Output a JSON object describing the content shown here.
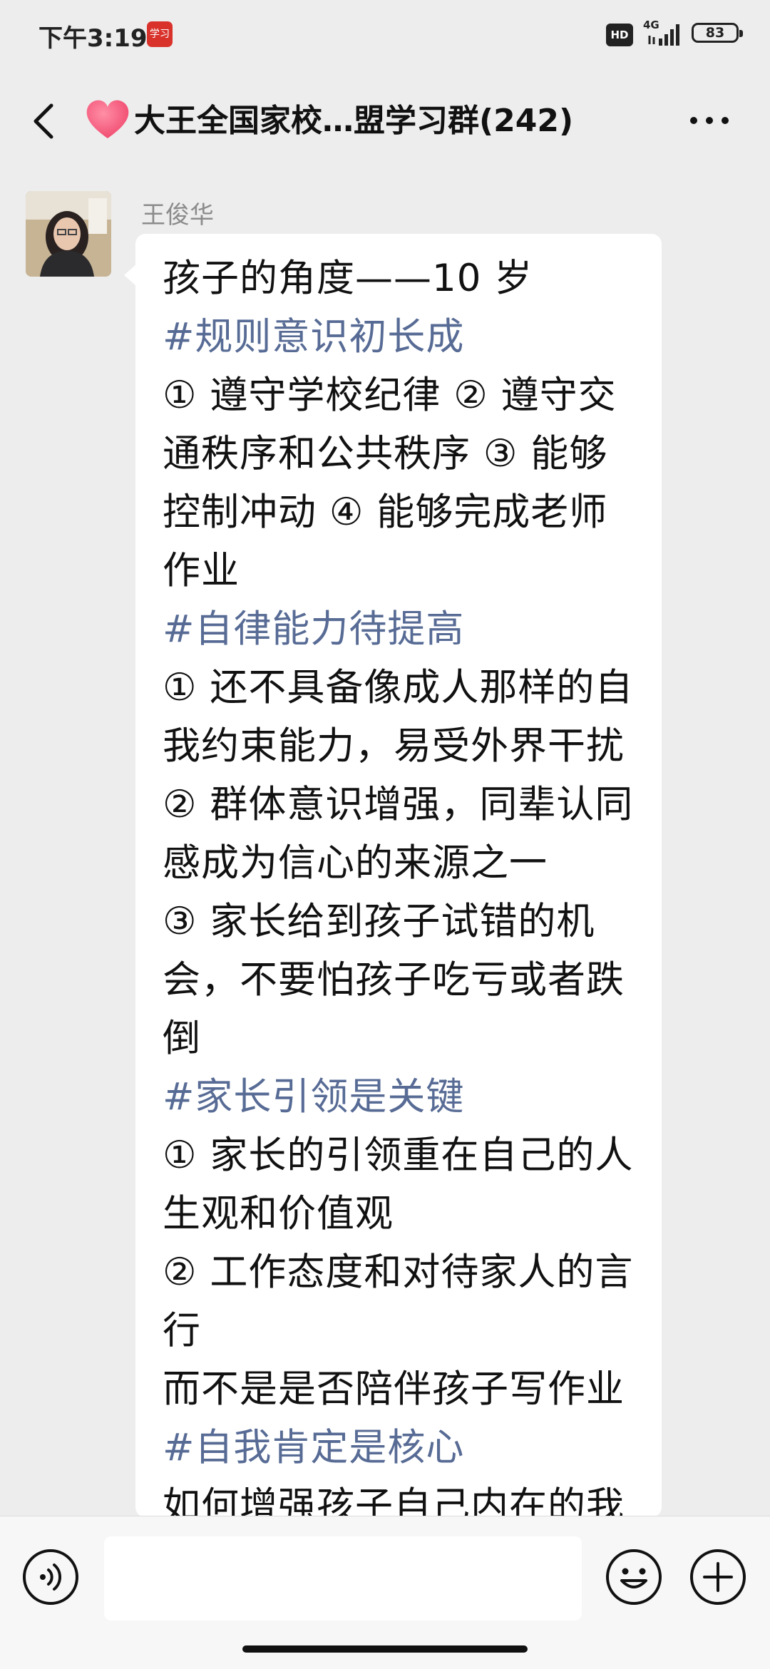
{
  "status_bar": {
    "time": "下午3:19",
    "app_badge": "学习",
    "hd": "HD",
    "network": "4G",
    "battery": "83"
  },
  "header": {
    "title": "大王全国家校…盟学习群(242)",
    "icons": [
      "back-icon",
      "heart-icon",
      "more-icon"
    ]
  },
  "message": {
    "sender": "王俊华",
    "lines": [
      {
        "text": "孩子的角度——10 岁",
        "tag": false
      },
      {
        "text": "#规则意识初长成",
        "tag": true
      },
      {
        "text": "① 遵守学校纪律 ② 遵守交",
        "tag": false
      },
      {
        "text": "通秩序和公共秩序 ③ 能够",
        "tag": false
      },
      {
        "text": "控制冲动 ④ 能够完成老师",
        "tag": false
      },
      {
        "text": "作业",
        "tag": false
      },
      {
        "text": "#自律能力待提高",
        "tag": true
      },
      {
        "text": "① 还不具备像成人那样的自",
        "tag": false
      },
      {
        "text": "我约束能力，易受外界干扰",
        "tag": false
      },
      {
        "text": "② 群体意识增强，同辈认同",
        "tag": false
      },
      {
        "text": "感成为信心的来源之一",
        "tag": false
      },
      {
        "text": "③ 家长给到孩子试错的机",
        "tag": false
      },
      {
        "text": "会，不要怕孩子吃亏或者跌",
        "tag": false
      },
      {
        "text": "倒",
        "tag": false
      },
      {
        "text": "#家长引领是关键",
        "tag": true
      },
      {
        "text": "① 家长的引领重在自己的人",
        "tag": false
      },
      {
        "text": "生观和价值观",
        "tag": false
      },
      {
        "text": "② 工作态度和对待家人的言",
        "tag": false
      },
      {
        "text": "行",
        "tag": false
      },
      {
        "text": "而不是是否陪伴孩子写作业",
        "tag": false
      },
      {
        "text": "#自我肯定是核心",
        "tag": true
      },
      {
        "text": "如何增强孩子自己内在的我",
        "tag": false
      }
    ]
  },
  "input_bar": {
    "text_value": "",
    "icons": [
      "voice-icon",
      "emoji-icon",
      "plus-icon"
    ]
  },
  "colors": {
    "background": "#ededed",
    "bubble": "#ffffff",
    "tag_text": "#576b95",
    "name_text": "#8b8b8b"
  }
}
